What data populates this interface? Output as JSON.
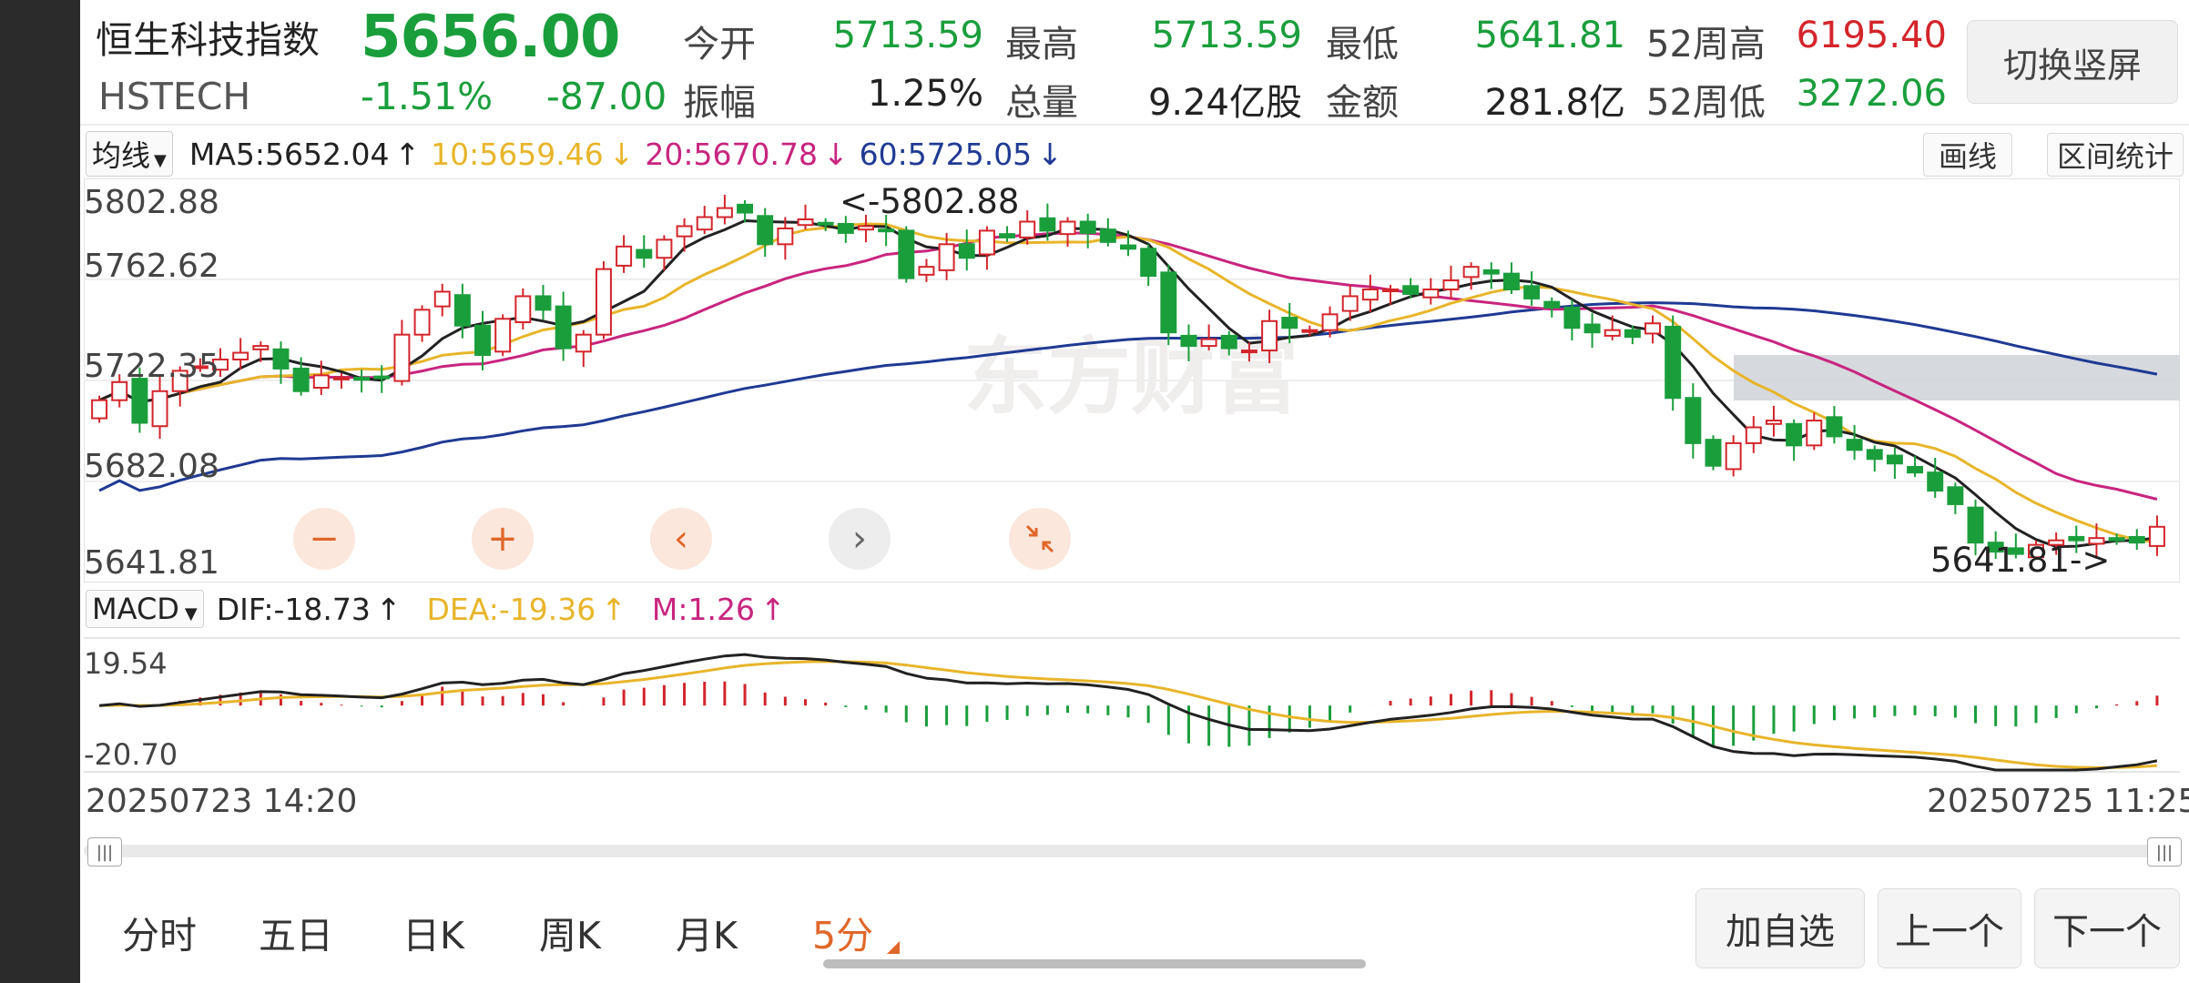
{
  "header": {
    "name": "恒生科技指数",
    "code": "HSTECH",
    "price": "5656.00",
    "change_pct": "-1.51%",
    "change": "-87.00",
    "stats": [
      {
        "label": "今开",
        "value": "5713.59",
        "color": "#1a9e3c"
      },
      {
        "label": "最高",
        "value": "5713.59",
        "color": "#1a9e3c"
      },
      {
        "label": "最低",
        "value": "5641.81",
        "color": "#1a9e3c"
      },
      {
        "label": "52周高",
        "value": "6195.40",
        "color": "#d3252b"
      },
      {
        "label": "振幅",
        "value": "1.25%",
        "color": "#222222"
      },
      {
        "label": "总量",
        "value": "9.24亿股",
        "color": "#222222"
      },
      {
        "label": "金额",
        "value": "281.8亿",
        "color": "#222222"
      },
      {
        "label": "52周低",
        "value": "3272.06",
        "color": "#1a9e3c"
      }
    ],
    "rotate_button": "切换竖屏"
  },
  "ma_bar": {
    "dropdown": "均线",
    "ma5": "MA5:5652.04",
    "ma10": "10:5659.46",
    "ma20": "20:5670.78",
    "ma60": "60:5725.05",
    "arrow_up": "↑",
    "arrow_down": "↓",
    "draw_button": "画线",
    "range_button": "区间统计",
    "colors": {
      "ma5": "#222222",
      "ma10": "#e8b52a",
      "ma20": "#c8257f",
      "ma60": "#1f3a93"
    }
  },
  "kline": {
    "y_labels": [
      "5802.88",
      "5762.62",
      "5722.35",
      "5682.08",
      "5641.81"
    ],
    "high_marker": "<-5802.88",
    "low_marker": "5641.81->",
    "watermark": "东方财富",
    "zoom_icons": [
      "minus-icon",
      "plus-icon",
      "chevron-left-icon",
      "chevron-right-icon",
      "shrink-icon"
    ]
  },
  "macd_bar": {
    "dropdown": "MACD",
    "dif": "DIF:-18.73",
    "dea": "DEA:-19.36",
    "m": "M:1.26",
    "arrow": "↑",
    "y_top": "19.54",
    "y_bottom": "-20.70",
    "colors": {
      "dif": "#222222",
      "dea": "#e8b52a",
      "m": "#c8257f"
    }
  },
  "time_axis": {
    "start": "20250723 14:20",
    "end": "20250725 11:25"
  },
  "tabs": [
    "分时",
    "五日",
    "日K",
    "周K",
    "月K",
    "5分"
  ],
  "active_tab": "5分",
  "footer_buttons": {
    "add": "加自选",
    "prev": "上一个",
    "next": "下一个"
  },
  "chart_data": {
    "type": "candlestick",
    "ylim": [
      5641.81,
      5802.88
    ],
    "high": 5802.88,
    "low": 5641.81,
    "closes": [
      5712,
      5720,
      5702,
      5716,
      5725,
      5727,
      5730,
      5733,
      5736,
      5726,
      5716,
      5723,
      5722,
      5721,
      5722,
      5741,
      5752,
      5760,
      5745,
      5732,
      5748,
      5758,
      5752,
      5735,
      5741,
      5770,
      5780,
      5775,
      5783,
      5789,
      5793,
      5797,
      5795,
      5781,
      5788,
      5792,
      5790,
      5786,
      5789,
      5787,
      5766,
      5771,
      5781,
      5775,
      5787,
      5784,
      5791,
      5787,
      5791,
      5786,
      5782,
      5779,
      5767,
      5742,
      5736,
      5739,
      5735,
      5734,
      5747,
      5744,
      5743,
      5750,
      5758,
      5761,
      5761,
      5759,
      5761,
      5765,
      5771,
      5768,
      5761,
      5757,
      5753,
      5744,
      5742,
      5743,
      5740,
      5746,
      5713,
      5693,
      5683,
      5693,
      5700,
      5703,
      5692,
      5703,
      5696,
      5690,
      5686,
      5684,
      5680,
      5672,
      5666,
      5649,
      5645,
      5644,
      5648,
      5650,
      5650,
      5651,
      5650,
      5649,
      5656
    ]
  }
}
